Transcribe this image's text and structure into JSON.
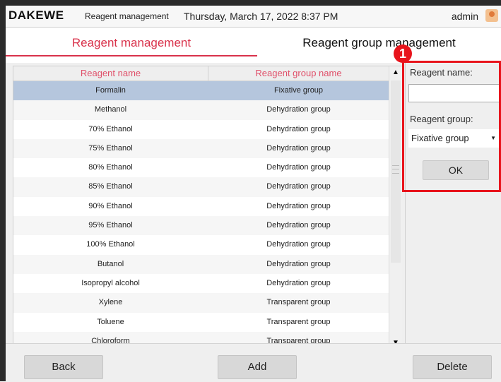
{
  "header": {
    "logo": "DAKEWE",
    "section": "Reagent management",
    "datetime": "Thursday, March 17, 2022  8:37 PM",
    "user": "admin"
  },
  "tabs": [
    {
      "label": "Reagent management",
      "active": true
    },
    {
      "label": "Reagent group management",
      "active": false
    }
  ],
  "table": {
    "columns": [
      "Reagent name",
      "Reagent group name"
    ],
    "rows": [
      {
        "name": "Formalin",
        "group": "Fixative group",
        "selected": true
      },
      {
        "name": "Methanol",
        "group": "Dehydration group"
      },
      {
        "name": "70% Ethanol",
        "group": "Dehydration group"
      },
      {
        "name": "75% Ethanol",
        "group": "Dehydration group"
      },
      {
        "name": "80% Ethanol",
        "group": "Dehydration group"
      },
      {
        "name": "85% Ethanol",
        "group": "Dehydration group"
      },
      {
        "name": "90% Ethanol",
        "group": "Dehydration group"
      },
      {
        "name": "95% Ethanol",
        "group": "Dehydration group"
      },
      {
        "name": "100% Ethanol",
        "group": "Dehydration group"
      },
      {
        "name": "Butanol",
        "group": "Dehydration group"
      },
      {
        "name": "Isopropyl alcohol",
        "group": "Dehydration group"
      },
      {
        "name": "Xylene",
        "group": "Transparent group"
      },
      {
        "name": "Toluene",
        "group": "Transparent group"
      },
      {
        "name": "Chloroform",
        "group": "Transparent group"
      }
    ]
  },
  "edit_panel": {
    "name_label": "Reagent name:",
    "name_value": "",
    "group_label": "Reagent group:",
    "group_value": "Fixative group",
    "ok_label": "OK"
  },
  "annotation": {
    "number": "1",
    "color": "#e8141c"
  },
  "footer": {
    "back": "Back",
    "add": "Add",
    "delete": "Delete"
  },
  "colors": {
    "accent": "#d9324b",
    "selected_row": "#b5c6dd"
  }
}
